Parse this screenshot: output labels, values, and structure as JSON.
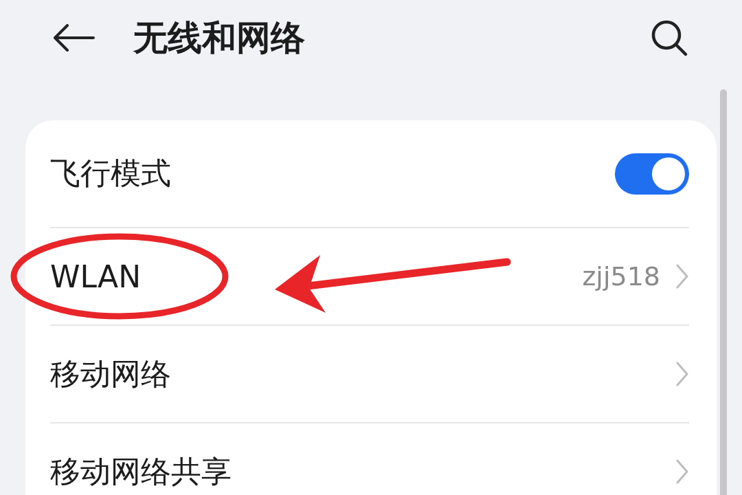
{
  "header": {
    "title": "无线和网络"
  },
  "rows": [
    {
      "kind": "toggle",
      "label": "飞行模式",
      "on": true,
      "highlighted": false
    },
    {
      "kind": "link",
      "label": "WLAN",
      "value": "zjj518",
      "highlighted": true
    },
    {
      "kind": "link",
      "label": "移动网络",
      "highlighted": false
    },
    {
      "kind": "link",
      "label": "移动网络共享",
      "highlighted": false
    }
  ]
}
